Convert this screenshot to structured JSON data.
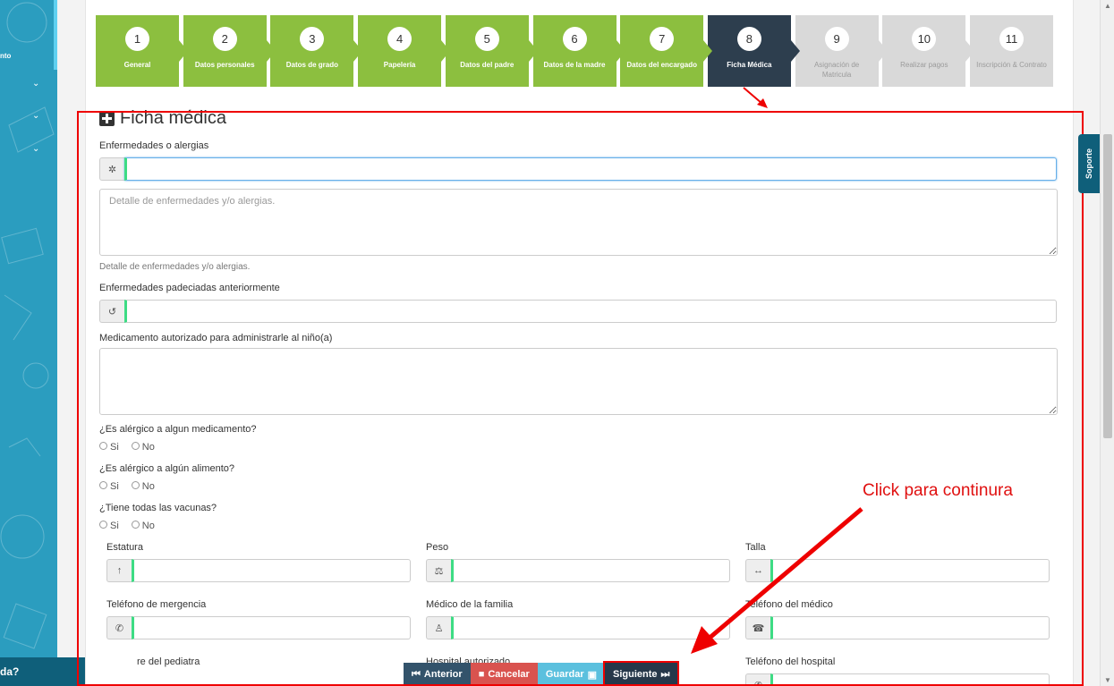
{
  "sidebar": {
    "partial_text": "nto",
    "help_label": "da?"
  },
  "steps": [
    {
      "num": "1",
      "label": "General",
      "state": "done"
    },
    {
      "num": "2",
      "label": "Datos personales",
      "state": "done"
    },
    {
      "num": "3",
      "label": "Datos de grado",
      "state": "done"
    },
    {
      "num": "4",
      "label": "Papelería",
      "state": "done"
    },
    {
      "num": "5",
      "label": "Datos del padre",
      "state": "done"
    },
    {
      "num": "6",
      "label": "Datos de la madre",
      "state": "done"
    },
    {
      "num": "7",
      "label": "Datos del encargado",
      "state": "done"
    },
    {
      "num": "8",
      "label": "Ficha Médica",
      "state": "active"
    },
    {
      "num": "9",
      "label": "Asignación de Matricula",
      "state": "todo"
    },
    {
      "num": "10",
      "label": "Realizar pagos",
      "state": "todo"
    },
    {
      "num": "11",
      "label": "Inscripción & Contrato",
      "state": "todo"
    }
  ],
  "form": {
    "title": "Ficha médica",
    "enfermedades_label": "Enfermedades o alergias",
    "detalle_placeholder": "Detalle de enfermedades y/o alergias.",
    "detalle_help": "Detalle de enfermedades y/o alergias.",
    "padeciadas_label": "Enfermedades padeciadas anteriormente",
    "medicamento_label": "Medicamento autorizado para administrarle al niño(a)",
    "q1": "¿Es alérgico a algun medicamento?",
    "q2": "¿Es alérgico a algún alimento?",
    "q3": "¿Tiene todas las vacunas?",
    "si": "Si",
    "no": "No",
    "estatura": "Estatura",
    "peso": "Peso",
    "talla": "Talla",
    "tel_emergencia": "Teléfono de mergencia",
    "medico_familia": "Médico de la familia",
    "tel_medico": "Teléfono del médico",
    "pediatra": "re del pediatra",
    "hospital": "Hospital autorizado",
    "tel_hospital": "Teléfono del hospital"
  },
  "annotation": {
    "text": "Click para continura"
  },
  "actions": {
    "prev": "Anterior",
    "cancel": "Cancelar",
    "save": "Guardar",
    "next": "Siguiente"
  },
  "support": {
    "label": "Soporte"
  },
  "colors": {
    "done": "#8cbf3f",
    "active": "#2d3e4e",
    "todo": "#d9d9d9",
    "annotation": "#e00000"
  }
}
